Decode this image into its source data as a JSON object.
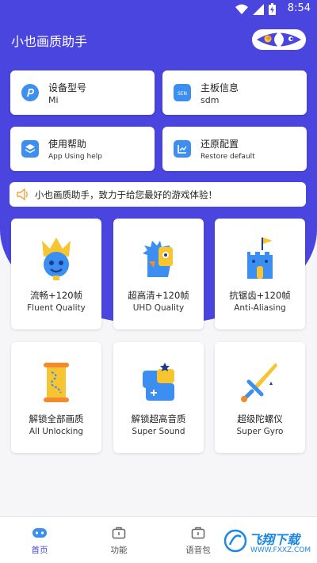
{
  "status_bar": {
    "time": "8:54"
  },
  "app": {
    "title": "小也画质助手"
  },
  "info_cards": [
    {
      "title": "设备型号",
      "value": "Mi"
    },
    {
      "title": "主板信息",
      "value": "sdm",
      "icon_text": "SEN"
    },
    {
      "title": "使用帮助",
      "value": "App Using help"
    },
    {
      "title": "还原配置",
      "value": "Restore default"
    }
  ],
  "notice": {
    "text": "小也画质助手，致力于给您最好的游戏体验！"
  },
  "features": [
    {
      "zh": "流畅+120帧",
      "en": "Fluent Quality"
    },
    {
      "zh": "超高清+120帧",
      "en": "UHD Quality"
    },
    {
      "zh": "抗锯齿+120帧",
      "en": "Anti-Aliasing"
    },
    {
      "zh": "解锁全部画质",
      "en": "All Unlocking"
    },
    {
      "zh": "解锁超高音质",
      "en": "Super Sound"
    },
    {
      "zh": "超级陀螺仪",
      "en": "Super Gyro"
    }
  ],
  "tabs": [
    {
      "label": "首页",
      "active": true
    },
    {
      "label": "功能",
      "active": false
    },
    {
      "label": "语音包",
      "active": false
    }
  ],
  "watermark": {
    "line1": "飞翔下载",
    "line2": "WWW.FXXZ.COM"
  },
  "colors": {
    "primary": "#4b45e0",
    "icon_blue": "#3c8ef0",
    "accent_yellow": "#f7c531"
  }
}
